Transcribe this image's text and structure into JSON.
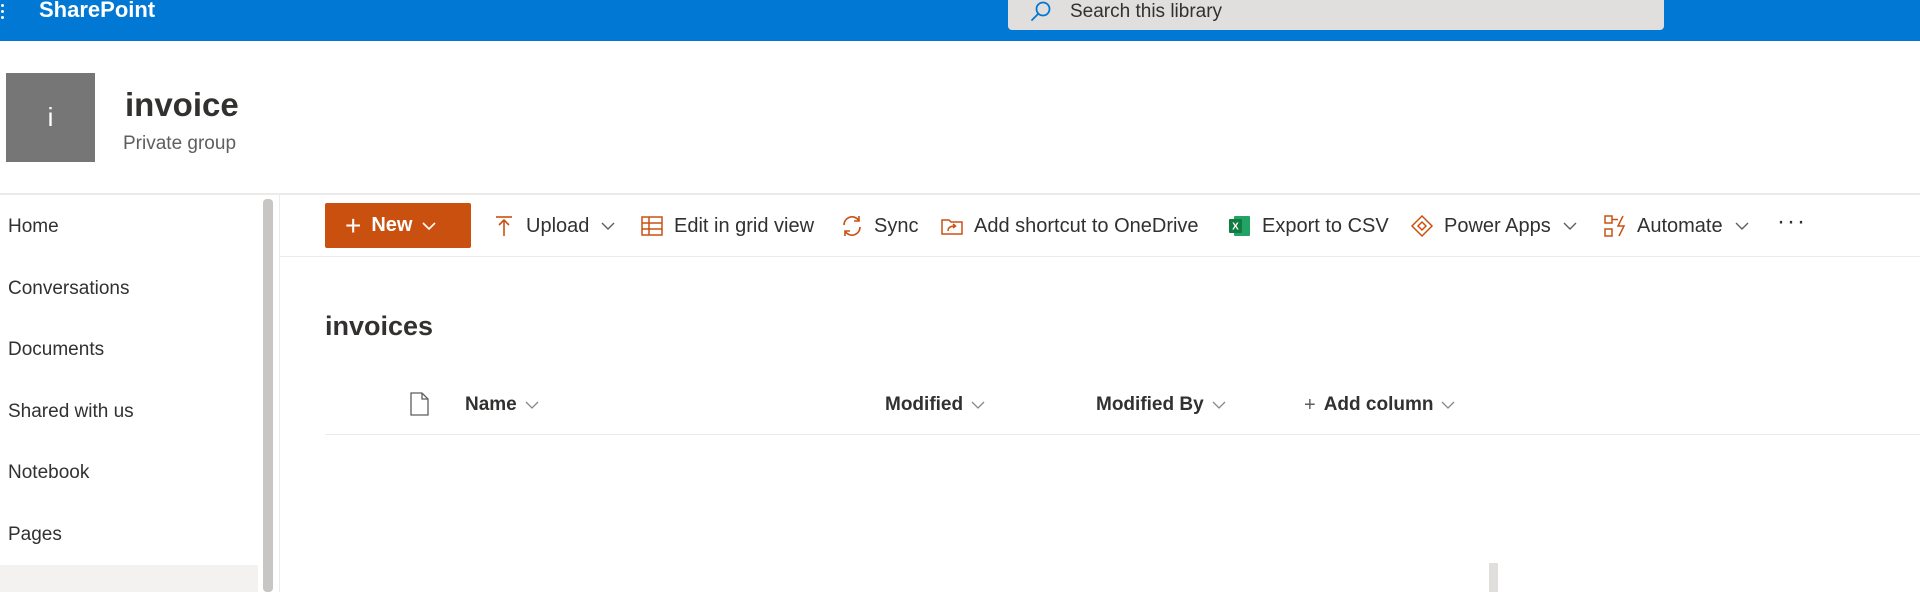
{
  "topbar": {
    "brand": "SharePoint",
    "search_placeholder": "Search this library",
    "color": "#0078d4"
  },
  "site": {
    "logo_letter": "i",
    "title": "invoice",
    "subtitle": "Private group"
  },
  "nav": {
    "items": [
      {
        "label": "Home"
      },
      {
        "label": "Conversations"
      },
      {
        "label": "Documents"
      },
      {
        "label": "Shared with us"
      },
      {
        "label": "Notebook"
      },
      {
        "label": "Pages"
      }
    ]
  },
  "commands": {
    "new_label": "New",
    "upload": "Upload",
    "grid": "Edit in grid view",
    "sync": "Sync",
    "shortcut": "Add shortcut to OneDrive",
    "export": "Export to CSV",
    "powerapps": "Power Apps",
    "automate": "Automate",
    "more": "···",
    "accent": "#ca5010"
  },
  "library": {
    "title": "invoices",
    "columns": {
      "name": "Name",
      "modified": "Modified",
      "modified_by": "Modified By",
      "add_column": "Add column",
      "add_plus": "+"
    }
  }
}
